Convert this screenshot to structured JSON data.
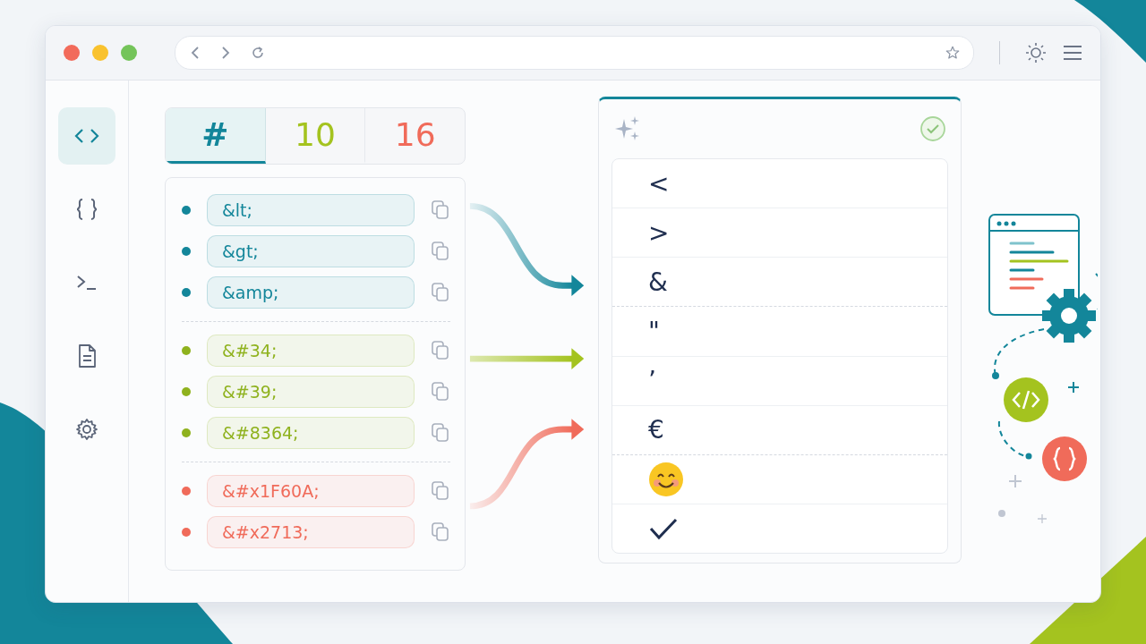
{
  "sidebar": {
    "items": [
      {
        "kind": "code",
        "selected": true
      },
      {
        "kind": "braces",
        "selected": false
      },
      {
        "kind": "terminal",
        "selected": false
      },
      {
        "kind": "document",
        "selected": false
      },
      {
        "kind": "settings",
        "selected": false
      }
    ]
  },
  "tabs": [
    {
      "label": "#",
      "selected": true,
      "color": "#13869a"
    },
    {
      "label": "10",
      "selected": false,
      "color": "#a4c31f"
    },
    {
      "label": "16",
      "selected": false,
      "color": "#f06b5a"
    }
  ],
  "entities": [
    {
      "color": "#13869a",
      "items": [
        "&lt;",
        "&gt;",
        "&amp;"
      ]
    },
    {
      "color": "#8fb21e",
      "items": [
        "&#34;",
        "&#39;",
        "&#8364;"
      ]
    },
    {
      "color": "#f06b5a",
      "items": [
        "&#x1F60A;",
        "&#x2713;"
      ]
    }
  ],
  "results": [
    {
      "items": [
        {
          "kind": "char",
          "text": "<"
        },
        {
          "kind": "char",
          "text": ">"
        },
        {
          "kind": "char",
          "text": "&"
        }
      ]
    },
    {
      "items": [
        {
          "kind": "char",
          "text": "\""
        },
        {
          "kind": "char",
          "text": "’"
        },
        {
          "kind": "char",
          "text": "€"
        }
      ]
    },
    {
      "items": [
        {
          "kind": "emoji"
        },
        {
          "kind": "check"
        }
      ]
    }
  ]
}
